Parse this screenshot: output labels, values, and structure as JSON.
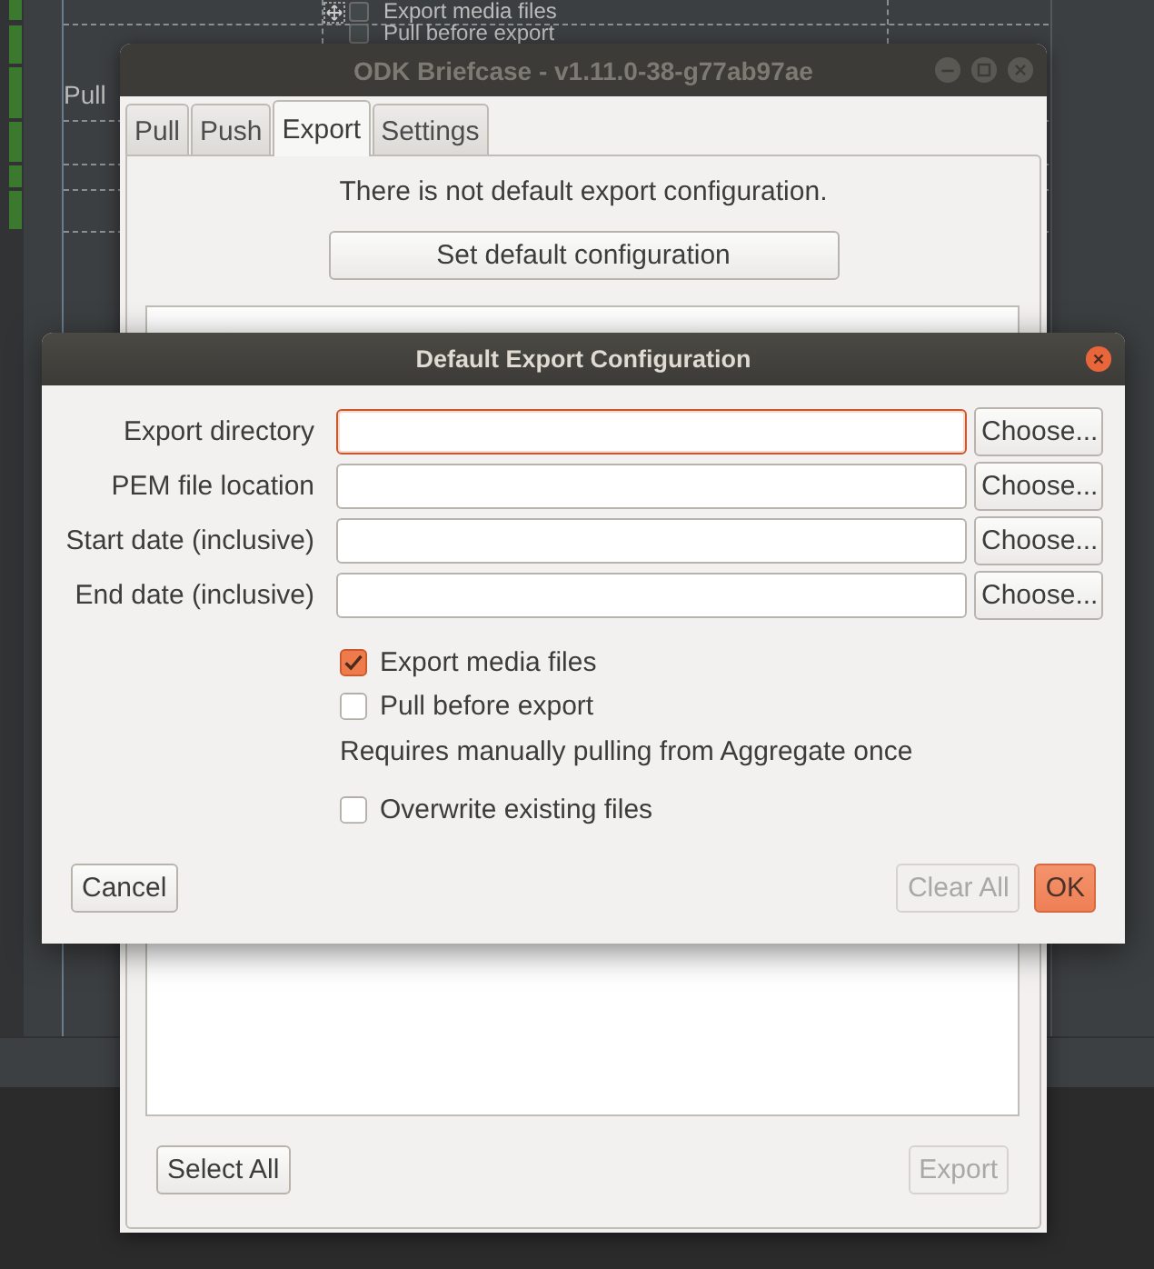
{
  "designer_background": {
    "checkboxes": [
      {
        "label": "Export media files",
        "checked": false
      },
      {
        "label": "Pull before export",
        "checked": false
      }
    ],
    "label": "Pull"
  },
  "main_window": {
    "title": "ODK Briefcase - v1.11.0-38-g77ab97ae",
    "tabs": [
      {
        "label": "Pull",
        "selected": false
      },
      {
        "label": "Push",
        "selected": false
      },
      {
        "label": "Export",
        "selected": true
      },
      {
        "label": "Settings",
        "selected": false
      }
    ],
    "export_panel": {
      "message": "There is not default export configuration.",
      "set_default_button": "Set default configuration",
      "buttons_left": [
        {
          "label": "Select All",
          "disabled": false
        }
      ],
      "buttons_right": [
        {
          "label": "Export",
          "disabled": true
        }
      ]
    }
  },
  "dialog": {
    "title": "Default Export Configuration",
    "fields": [
      {
        "label": "Export directory",
        "error": true,
        "button": "Choose..."
      },
      {
        "label": "PEM file location",
        "error": false,
        "button": "Choose..."
      },
      {
        "label": "Start date (inclusive)",
        "error": false,
        "button": "Choose..."
      },
      {
        "label": "End date (inclusive)",
        "error": false,
        "button": "Choose..."
      }
    ],
    "options": [
      {
        "kind": "checkbox",
        "label": "Export media files",
        "checked": true
      },
      {
        "kind": "checkbox",
        "label": "Pull before export",
        "checked": false
      },
      {
        "kind": "note",
        "text": "Requires manually pulling from Aggregate once"
      },
      {
        "kind": "checkbox",
        "label": "Overwrite existing files",
        "checked": false
      }
    ],
    "buttons_left": [
      {
        "label": "Cancel",
        "kind": "cancel",
        "disabled": false
      }
    ],
    "buttons_right": [
      {
        "label": "Clear All",
        "kind": "clear",
        "disabled": true
      },
      {
        "label": "OK",
        "kind": "ok",
        "disabled": false
      }
    ]
  }
}
